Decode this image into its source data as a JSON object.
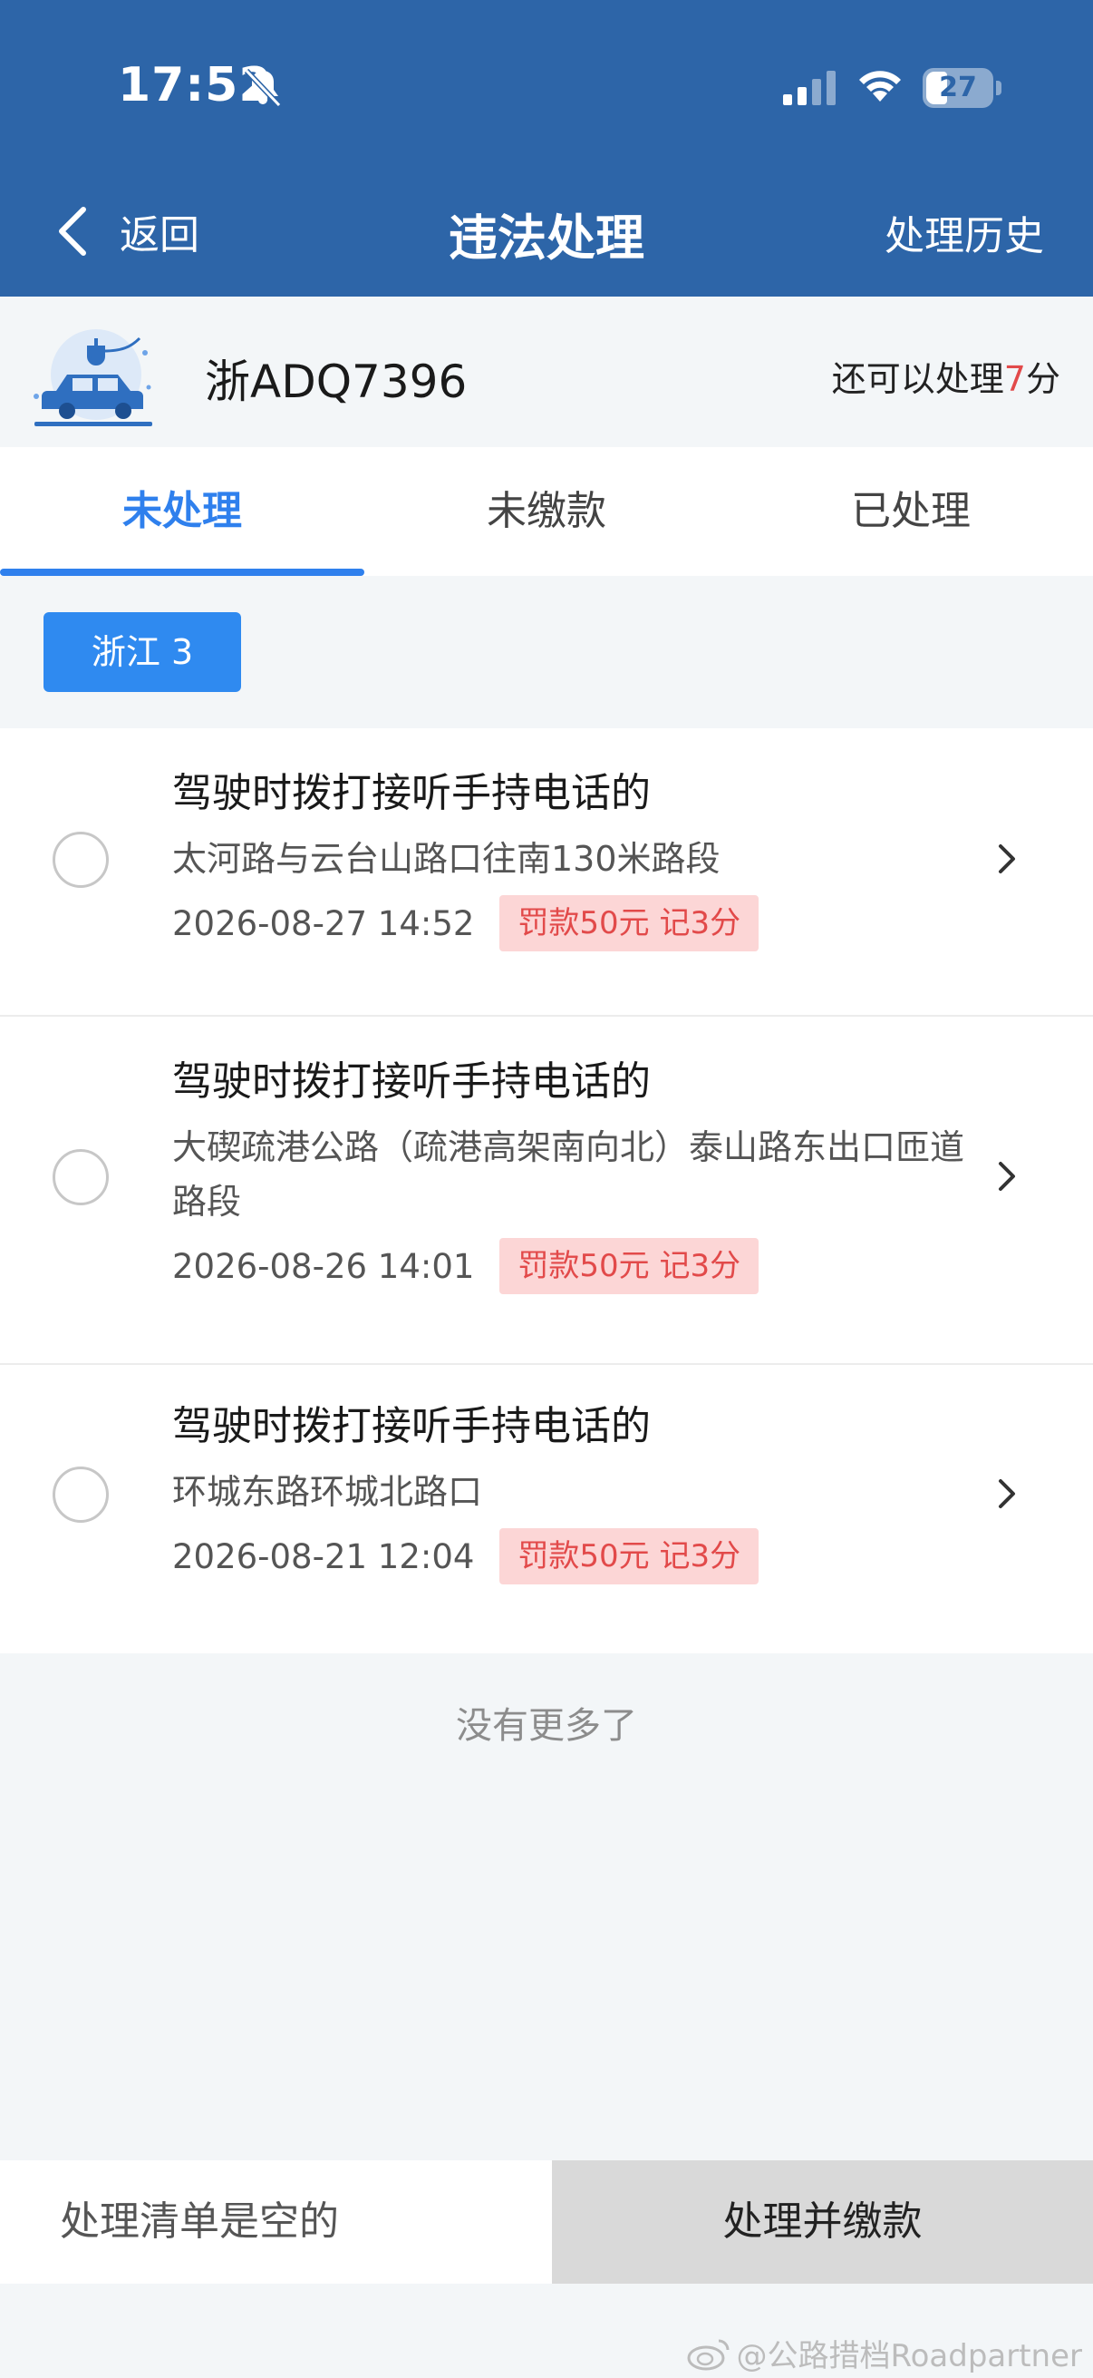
{
  "status_bar": {
    "time": "17:52",
    "battery": "27"
  },
  "nav": {
    "back_label": "返回",
    "title": "违法处理",
    "history_label": "处理历史"
  },
  "vehicle": {
    "plate": "浙ADQ7396",
    "remain_prefix": "还可以处理",
    "remain_points": "7",
    "remain_suffix": "分"
  },
  "tabs": [
    {
      "label": "未处理",
      "active": true
    },
    {
      "label": "未缴款",
      "active": false
    },
    {
      "label": "已处理",
      "active": false
    }
  ],
  "region_filter": {
    "label": "浙江 3"
  },
  "violations": [
    {
      "title": "驾驶时拨打接听手持电话的",
      "location": "太河路与云台山路口往南130米路段",
      "datetime": "2026-08-27 14:52",
      "penalty": "罚款50元 记3分"
    },
    {
      "title": "驾驶时拨打接听手持电话的",
      "location": "大碶疏港公路（疏港高架南向北）泰山路东出口匝道路段",
      "datetime": "2026-08-26 14:01",
      "penalty": "罚款50元 记3分"
    },
    {
      "title": "驾驶时拨打接听手持电话的",
      "location": "环城东路环城北路口",
      "datetime": "2026-08-21 12:04",
      "penalty": "罚款50元 记3分"
    }
  ],
  "list_footer": "没有更多了",
  "bottom_bar": {
    "cart_status": "处理清单是空的",
    "pay_label": "处理并缴款"
  },
  "watermark": "@公路措档Roadpartner",
  "colors": {
    "header_bg": "#2d65a8",
    "accent": "#2f80ed",
    "penalty_text": "#e24a4a",
    "penalty_bg": "#fcd6d6"
  }
}
